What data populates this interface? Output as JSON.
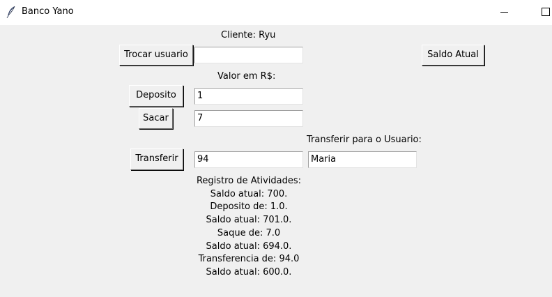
{
  "window": {
    "title": "Banco Yano",
    "app_icon": "feather-icon",
    "minimize_icon": "minimize-icon",
    "maximize_icon": "maximize-icon"
  },
  "client_label": "Cliente: Ryu",
  "buttons": {
    "trocar_usuario": "Trocar usuario",
    "saldo_atual": "Saldo Atual",
    "deposito": "Deposito",
    "sacar": "Sacar",
    "transferir": "Transferir"
  },
  "fields": {
    "usuario": "",
    "deposito_valor": "1",
    "saque_valor": "7",
    "transferir_valor": "94",
    "transferir_usuario": "Maria"
  },
  "labels": {
    "valor": "Valor em R$:",
    "transferir_para": "Transferir para o Usuario:"
  },
  "log": {
    "title": "Registro de Atividades:",
    "lines": [
      "Saldo atual: 700.",
      "Deposito de: 1.0.",
      "Saldo atual: 701.0.",
      "Saque de: 7.0",
      "Saldo atual: 694.0.",
      "Transferencia de: 94.0",
      "Saldo atual: 600.0."
    ]
  },
  "colors": {
    "window_bg": "#f0f0f0",
    "titlebar_bg": "#ffffff",
    "entry_bg": "#ffffff"
  }
}
